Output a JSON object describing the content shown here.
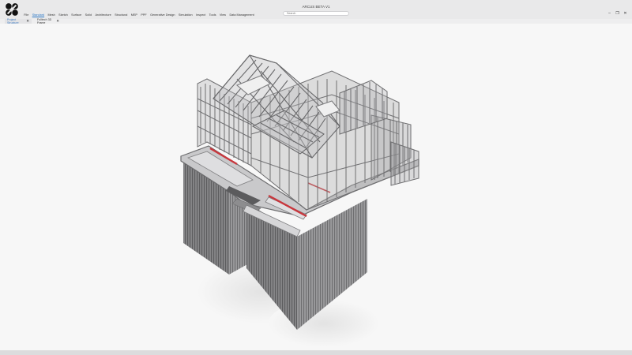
{
  "app": {
    "title": "ARCUS BETA V1",
    "logo_icon": "app-logo-icon"
  },
  "search": {
    "placeholder": "Search"
  },
  "window_controls": {
    "minimize": "–",
    "restore": "❐",
    "close": "✕"
  },
  "menu": [
    "File",
    "Standard",
    "Mesh",
    "Sketch",
    "Surface",
    "Solid",
    "Architecture",
    "Structural",
    "MEP",
    "PPF",
    "Generative Design",
    "Simulation",
    "Inspect",
    "Tools",
    "View",
    "Data Management"
  ],
  "active_menu_index": 1,
  "tabs": [
    {
      "label": "Project Structure",
      "close": "✕"
    },
    {
      "label": "Fulltech 3D Frame",
      "close": "✕"
    }
  ],
  "colors": {
    "accent": "#2d79c7",
    "model_gray": "#8e8e90",
    "highlight_red": "#c8373d"
  }
}
